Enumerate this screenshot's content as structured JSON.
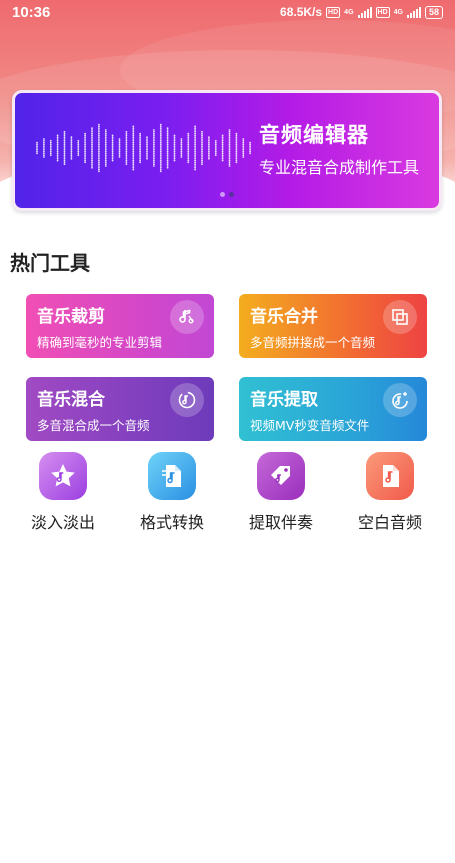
{
  "status_bar": {
    "time": "10:36",
    "network_speed": "68.5K/s",
    "hd_badge": "HD",
    "net_type": "4G",
    "battery": "58"
  },
  "banner": {
    "title": "音频编辑器",
    "subtitle": "专业混音合成制作工具",
    "page_count": 2,
    "active_page": 2
  },
  "section": {
    "title": "热门工具"
  },
  "cards": [
    {
      "title": "音乐裁剪",
      "desc": "精确到毫秒的专业剪辑",
      "icon": "scissors-note-icon"
    },
    {
      "title": "音乐合并",
      "desc": "多音频拼接成一个音频",
      "icon": "merge-squares-icon"
    },
    {
      "title": "音乐混合",
      "desc": "多音混合成一个音频",
      "icon": "mix-circle-icon"
    },
    {
      "title": "音乐提取",
      "desc": "视频MV秒变音频文件",
      "icon": "extract-note-icon"
    }
  ],
  "tools": [
    {
      "label": "淡入淡出",
      "icon": "fade-star-icon"
    },
    {
      "label": "格式转换",
      "icon": "format-file-icon"
    },
    {
      "label": "提取伴奏",
      "icon": "tag-music-icon"
    },
    {
      "label": "空白音频",
      "icon": "blank-audio-file-icon"
    }
  ],
  "colors": {
    "header_gradient": [
      "#ef6a6e",
      "#f6b3ae"
    ],
    "banner_gradient": [
      "#5123e9",
      "#d93ae0"
    ],
    "card_cut": [
      "#f04fb4",
      "#c148d4"
    ],
    "card_merge": [
      "#f3ad1e",
      "#ee4343"
    ],
    "card_mix": [
      "#a14ac3",
      "#6d3bba"
    ],
    "card_extract": [
      "#30c0d3",
      "#2588d9"
    ]
  }
}
